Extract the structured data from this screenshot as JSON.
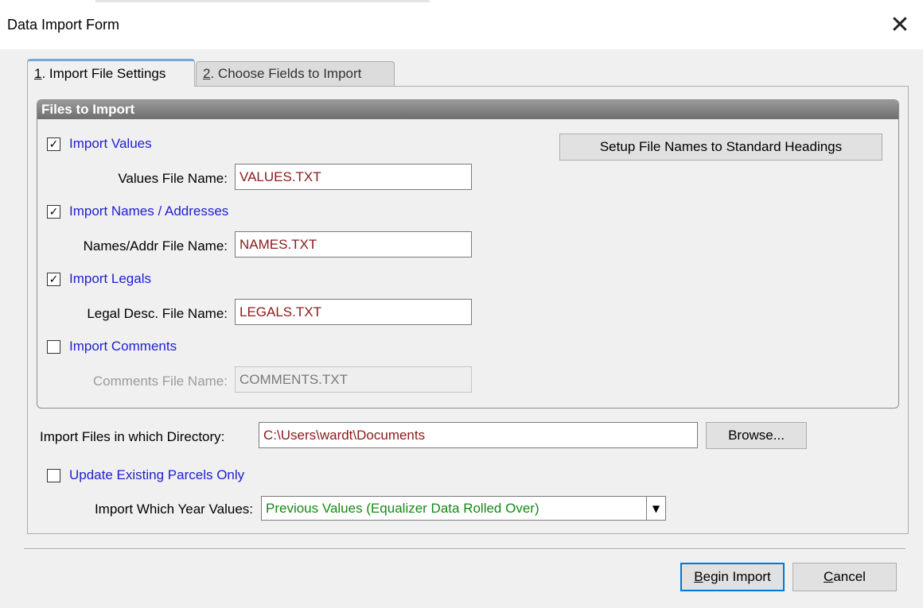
{
  "window": {
    "title": "Data Import Form",
    "close_glyph": "✕"
  },
  "tabs": [
    {
      "number": "1",
      "label": ". Import File Settings",
      "active": true
    },
    {
      "number": "2",
      "label": ". Choose Fields to Import",
      "active": false
    }
  ],
  "group": {
    "title": "Files to Import",
    "setup_button": "Setup File Names to Standard Headings",
    "rows": [
      {
        "checkbox_label": "Import Values",
        "checked": true,
        "field_label": "Values File Name:",
        "value": "VALUES.TXT",
        "enabled": true
      },
      {
        "checkbox_label": "Import Names / Addresses",
        "checked": true,
        "field_label": "Names/Addr File Name:",
        "value": "NAMES.TXT",
        "enabled": true
      },
      {
        "checkbox_label": "Import Legals",
        "checked": true,
        "field_label": "Legal Desc. File Name:",
        "value": "LEGALS.TXT",
        "enabled": true
      },
      {
        "checkbox_label": "Import Comments",
        "checked": false,
        "field_label": "Comments File Name:",
        "value": "COMMENTS.TXT",
        "enabled": false
      }
    ]
  },
  "directory": {
    "label": "Import Files in which Directory:",
    "value": "C:\\Users\\wardt\\Documents",
    "browse_button": "Browse..."
  },
  "update_existing": {
    "label": "Update Existing Parcels Only",
    "checked": false
  },
  "year_values": {
    "label": "Import Which Year Values:",
    "selected": "Previous Values (Equalizer Data Rolled Over)"
  },
  "footer": {
    "begin_first": "B",
    "begin_rest": "egin Import",
    "cancel_first": "C",
    "cancel_rest": "ancel"
  },
  "glyphs": {
    "check": "✓",
    "dropdown": "▼"
  },
  "colors": {
    "link_blue": "#2020d0",
    "value_red": "#8b1a1a",
    "combo_green": "#138a13",
    "default_button_border": "#0078d7"
  }
}
